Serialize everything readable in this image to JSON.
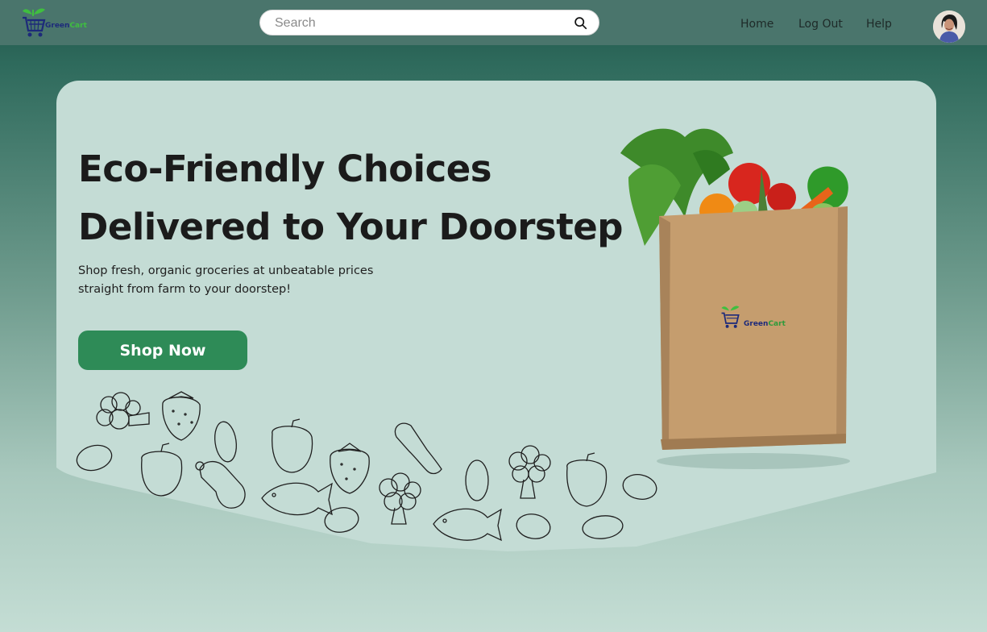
{
  "brand": {
    "name_part1": "Green",
    "name_part2": "Cart"
  },
  "search": {
    "placeholder": "Search"
  },
  "nav": {
    "home": "Home",
    "logout": "Log Out",
    "help": "Help"
  },
  "hero": {
    "headline_line1": "Eco-Friendly Choices",
    "headline_line2": "Delivered to Your Doorstep",
    "subtext": "Shop fresh, organic groceries at unbeatable prices\n straight from farm to your doorstep!",
    "cta_label": "Shop Now"
  },
  "colors": {
    "topbar": "#4a756c",
    "hero_card": "#c4dcd5",
    "cta": "#2e8b57",
    "brand_blue": "#1d2a7a",
    "brand_green": "#3fbf3f"
  },
  "icons": [
    "cart-logo-icon",
    "search-icon",
    "user-avatar",
    "grocery-bag-image",
    "food-doodle-illustrations"
  ]
}
